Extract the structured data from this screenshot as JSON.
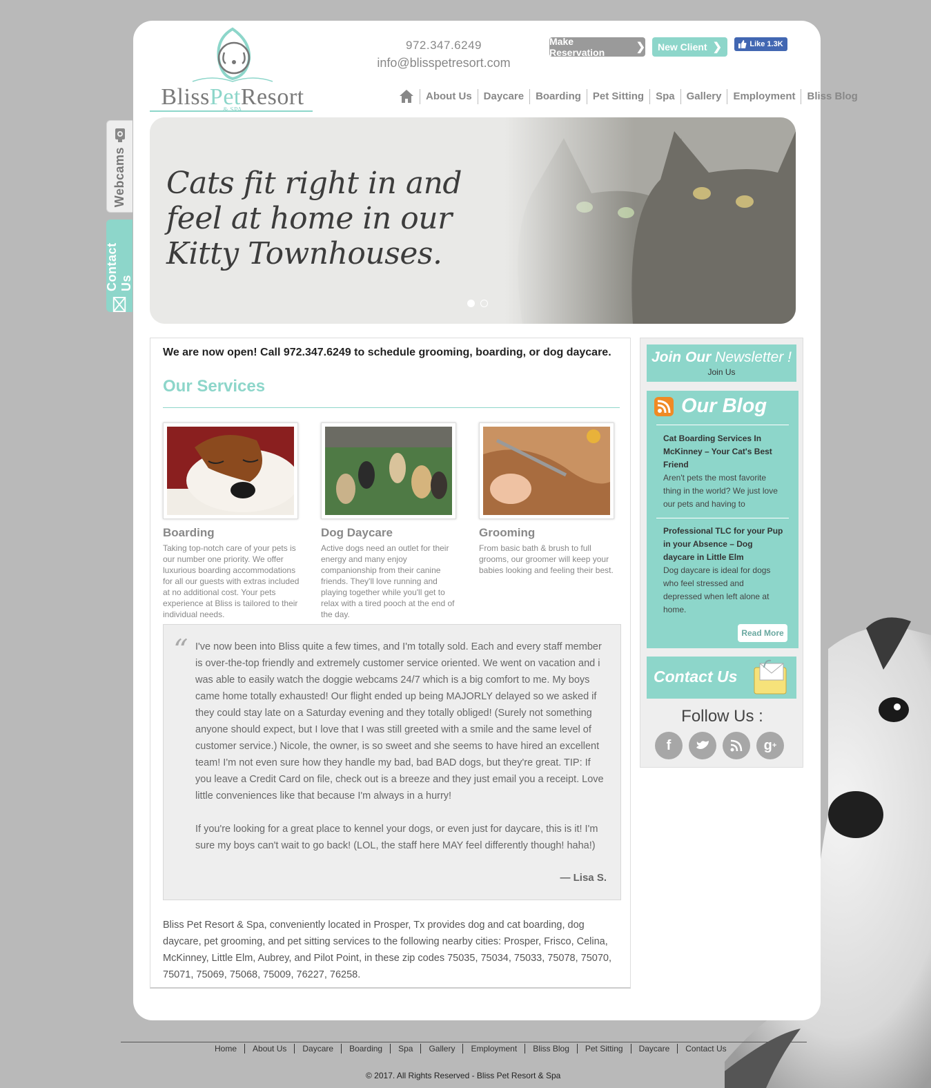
{
  "side_tabs": {
    "webcams": "Webcams",
    "contact": "Contact Us"
  },
  "header": {
    "logo": {
      "word1": "Bliss",
      "word2": "Pet",
      "word3": "Resort",
      "sub": "& SPA"
    },
    "phone": "972.347.6249",
    "email": "info@blisspetresort.com",
    "reserve_label": "Make Reservation",
    "newclient_label": "New Client",
    "fb_like": "Like 1.3K"
  },
  "nav": {
    "items": [
      "About Us",
      "Daycare",
      "Boarding",
      "Pet Sitting",
      "Spa",
      "Gallery",
      "Employment",
      "Bliss Blog"
    ]
  },
  "hero": {
    "text": "Cats fit right in and feel at home in our Kitty Townhouses."
  },
  "main": {
    "announcement": "We are now open! Call 972.347.6249 to schedule grooming, boarding, or dog daycare.",
    "services_title": "Our Services",
    "services": [
      {
        "name": "Boarding",
        "desc": "Taking top-notch care of your pets is our number one priority. We offer luxurious boarding accommodations for all our guests with extras included at no additional cost. Your pets experience at Bliss is tailored to their individual needs."
      },
      {
        "name": "Dog Daycare",
        "desc": "Active dogs need an outlet for their energy and many enjoy companionship from their canine friends. They'll love running and playing together while you'll get to relax with a tired pooch at the end of the day."
      },
      {
        "name": "Grooming",
        "desc": "From basic bath & brush to full grooms, our groomer will keep your babies looking and feeling their best."
      }
    ],
    "testimonial": {
      "p1": "I've now been into Bliss quite a few times, and I'm totally sold. Each and every staff member is over-the-top friendly and extremely customer service oriented. We went on vacation and i was able to easily watch the doggie webcams 24/7 which is a big comfort to me. My boys came home totally exhausted! Our flight ended up being MAJORLY delayed so we asked if they could stay late on a Saturday evening and they totally obliged! (Surely not something anyone should expect, but I love that I was still greeted with a smile and the same level of customer service.) Nicole, the owner, is so sweet and she seems to have hired an excellent team! I'm not even sure how they handle my bad, bad BAD dogs, but they're great. TIP: If you leave a Credit Card on file, check out is a breeze and they just email you a receipt. Love little conveniences like that because I'm always in a hurry!",
      "p2": "If you're looking for a great place to kennel your dogs, or even just for daycare, this is it! I'm sure my boys can't wait to go back! (LOL, the staff here MAY feel differently though! haha!)",
      "author": "— Lisa S."
    },
    "closing": "Bliss Pet Resort & Spa, conveniently located in Prosper, Tx provides dog and cat boarding, dog daycare, pet grooming, and pet sitting services to the following nearby cities: Prosper, Frisco, Celina, McKinney, Little Elm, Aubrey, and Pilot Point, in these zip codes 75035, 75034, 75033, 75078, 75070, 75071, 75069, 75068, 75009, 76227, 76258."
  },
  "sidebar": {
    "newsletter_a": "Join Our",
    "newsletter_b": "Newsletter !",
    "newsletter_sub": "Join Us",
    "blog_title": "Our Blog",
    "posts": [
      {
        "title": "Cat Boarding Services In McKinney – Your Cat's Best Friend",
        "excerpt": "Aren't pets the most favorite thing in the world? We just love our pets and having to"
      },
      {
        "title": "Professional TLC for your Pup in your Absence – Dog daycare in Little Elm",
        "excerpt": "Dog daycare is ideal for dogs who feel stressed and depressed when left alone at home."
      }
    ],
    "read_more": "Read More",
    "contact_title": "Contact Us",
    "follow": "Follow Us :",
    "social": [
      "facebook-icon",
      "twitter-icon",
      "rss-icon",
      "google-plus-icon"
    ]
  },
  "footer": {
    "links": [
      "Home",
      "About Us",
      "Daycare",
      "Boarding",
      "Spa",
      "Gallery",
      "Employment",
      "Bliss Blog",
      "Pet Sitting",
      "Daycare",
      "Contact Us"
    ],
    "copyright": "© 2017. All Rights Reserved - Bliss Pet Resort & Spa"
  },
  "colors": {
    "accent": "#8dd6ca",
    "gray_button": "#9a9a9a",
    "facebook": "#4267b2"
  }
}
